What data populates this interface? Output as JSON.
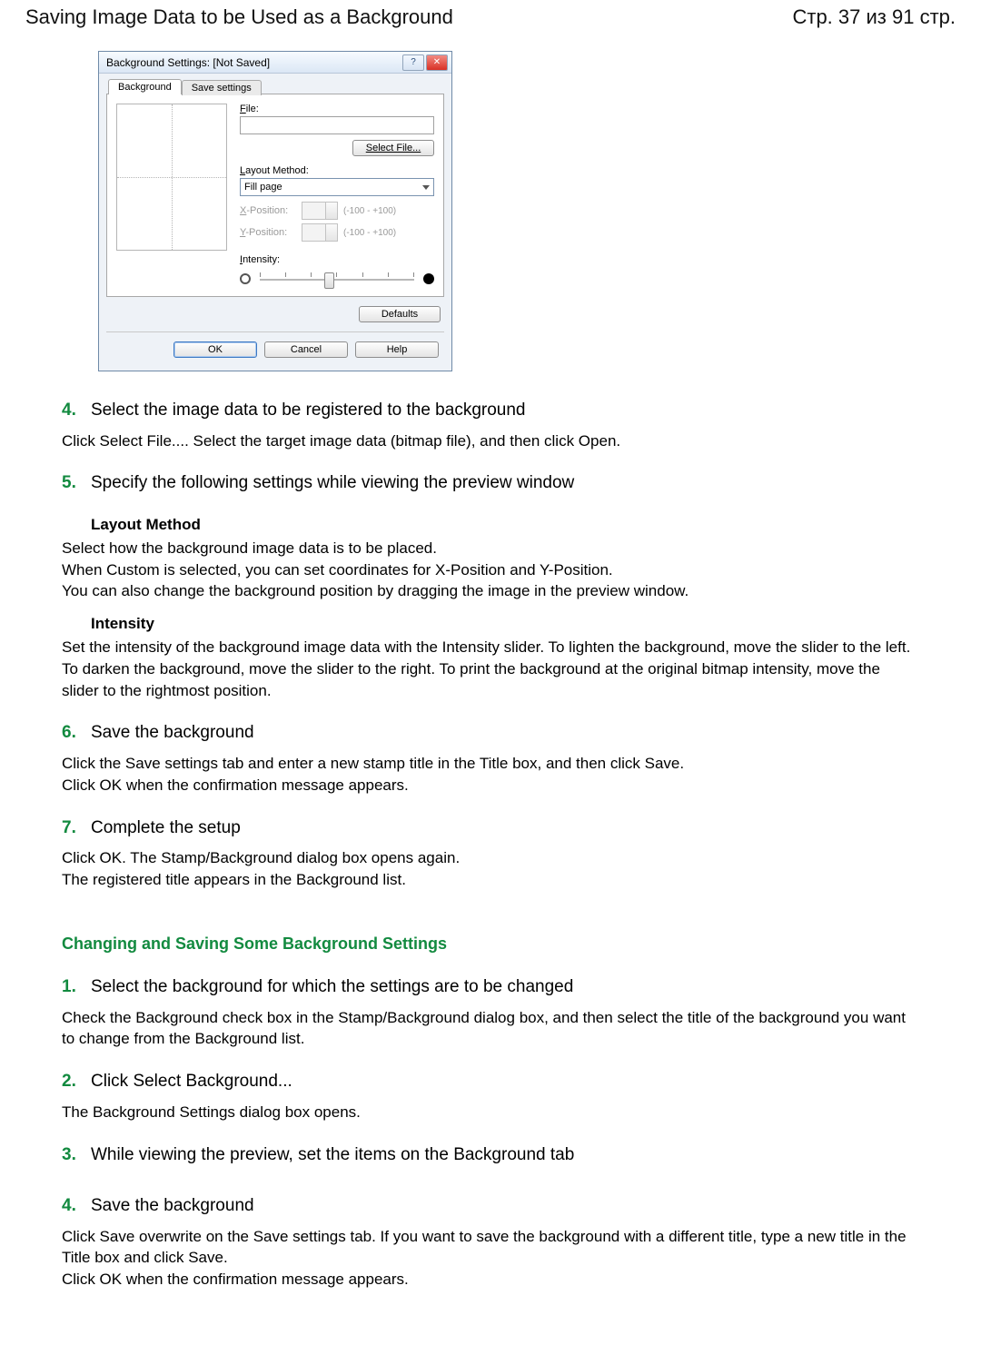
{
  "header": {
    "title": "Saving Image Data to be Used as a Background",
    "page_indicator": "Стр. 37 из 91 стр."
  },
  "dialog": {
    "title": "Background Settings: [Not Saved]",
    "window_help": "?",
    "window_close": "✕",
    "tabs": {
      "background": "Background",
      "save_settings": "Save settings"
    },
    "file_label": "File:",
    "select_file_btn": "Select File...",
    "layout_method_label": "Layout Method:",
    "layout_method_value": "Fill page",
    "x_position_label": "X-Position:",
    "y_position_label": "Y-Position:",
    "range_hint": "(-100 - +100)",
    "intensity_label": "Intensity:",
    "defaults_btn": "Defaults",
    "ok_btn": "OK",
    "cancel_btn": "Cancel",
    "help_btn": "Help"
  },
  "steps_a": [
    {
      "num": "4.",
      "heading": "Select the image data to be registered to the background",
      "paras": [
        "Click Select File.... Select the target image data (bitmap file), and then click Open."
      ]
    },
    {
      "num": "5.",
      "heading": "Specify the following settings while viewing the preview window",
      "subsections": [
        {
          "title": "Layout Method",
          "paras": [
            "Select how the background image data is to be placed.",
            "When Custom is selected, you can set coordinates for X-Position and Y-Position.",
            "You can also change the background position by dragging the image in the preview window."
          ]
        },
        {
          "title": "Intensity",
          "paras": [
            "Set the intensity of the background image data with the Intensity slider. To lighten the background, move the slider to the left. To darken the background, move the slider to the right. To print the background at the original bitmap intensity, move the slider to the rightmost position."
          ]
        }
      ]
    },
    {
      "num": "6.",
      "heading": "Save the background",
      "paras": [
        "Click the Save settings tab and enter a new stamp title in the Title box, and then click Save.",
        "Click OK when the confirmation message appears."
      ]
    },
    {
      "num": "7.",
      "heading": "Complete the setup",
      "paras": [
        "Click OK. The Stamp/Background dialog box opens again.",
        "The registered title appears in the Background list."
      ]
    }
  ],
  "section_b_title": "Changing and Saving Some Background Settings",
  "steps_b": [
    {
      "num": "1.",
      "heading": "Select the background for which the settings are to be changed",
      "paras": [
        "Check the Background check box in the Stamp/Background dialog box, and then select the title of the background you want to change from the Background list."
      ]
    },
    {
      "num": "2.",
      "heading": "Click Select Background...",
      "paras": [
        "The Background Settings dialog box opens."
      ]
    },
    {
      "num": "3.",
      "heading": "While viewing the preview, set the items on the Background tab",
      "paras": []
    },
    {
      "num": "4.",
      "heading": "Save the background",
      "paras": [
        "Click Save overwrite on the Save settings tab. If you want to save the background with a different title, type a new title in the Title box and click Save.",
        "Click OK when the confirmation message appears."
      ]
    }
  ]
}
